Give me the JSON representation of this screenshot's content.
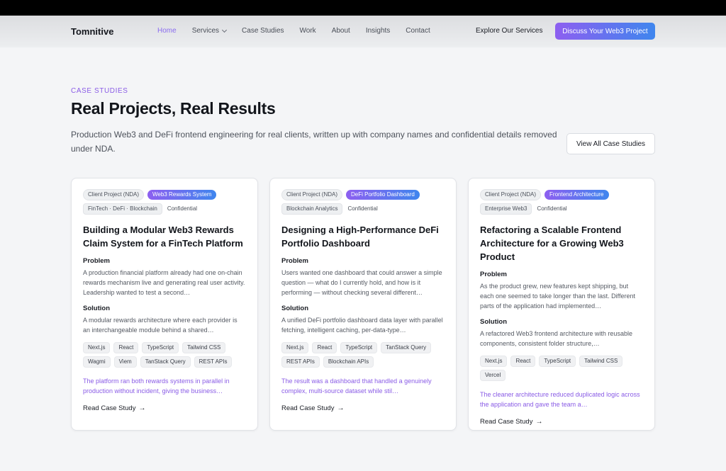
{
  "nav": {
    "logo": "Tomnitive",
    "links": [
      "Home",
      "Services",
      "Case Studies",
      "Work",
      "About",
      "Insights",
      "Contact"
    ],
    "explore": "Explore Our Services",
    "cta": "Discuss Your Web3 Project",
    "active_color": "#8a6cf0"
  },
  "hero": {
    "eyebrow": "CASE STUDIES",
    "title": "Real Projects, Real Results",
    "subtitle": "Production Web3 and DeFi frontend engineering for real clients, written up with company names and confidential details removed under NDA.",
    "view_all": "View All Case Studies"
  },
  "cards": [
    {
      "tag1": "Client Project (NDA)",
      "tag2": "Web3 Rewards System",
      "tag3": "FinTech · DeFi · Blockchain",
      "tag4": "Confidential",
      "title": "Building a Modular Web3 Rewards Claim System for a FinTech Platform",
      "problem_label": "Problem",
      "problem": "A production financial platform already had one on-chain rewards mechanism live and generating real user activity. Leadership wanted to test a second…",
      "solution_label": "Solution",
      "solution": "A modular rewards architecture where each provider is an interchangeable module behind a shared…",
      "tech": [
        "Next.js",
        "React",
        "TypeScript",
        "Tailwind CSS",
        "Wagmi",
        "Viem",
        "TanStack Query",
        "REST APIs"
      ],
      "result": "The platform ran both rewards systems in parallel in production without incident, giving the business…",
      "read": "Read Case Study"
    },
    {
      "tag1": "Client Project (NDA)",
      "tag2": "DeFi Portfolio Dashboard",
      "tag3": "Blockchain Analytics",
      "tag4": "Confidential",
      "title": "Designing a High-Performance DeFi Portfolio Dashboard",
      "problem_label": "Problem",
      "problem": "Users wanted one dashboard that could answer a simple question — what do I currently hold, and how is it performing — without checking several different…",
      "solution_label": "Solution",
      "solution": "A unified DeFi portfolio dashboard data layer with parallel fetching, intelligent caching, per-data-type…",
      "tech": [
        "Next.js",
        "React",
        "TypeScript",
        "TanStack Query",
        "REST APIs",
        "Blockchain APIs"
      ],
      "result": "The result was a dashboard that handled a genuinely complex, multi-source dataset while stil…",
      "read": "Read Case Study"
    },
    {
      "tag1": "Client Project (NDA)",
      "tag2": "Frontend Architecture",
      "tag3": "Enterprise Web3",
      "tag4": "Confidential",
      "title": "Refactoring a Scalable Frontend Architecture for a Growing Web3 Product",
      "problem_label": "Problem",
      "problem": "As the product grew, new features kept shipping, but each one seemed to take longer than the last. Different parts of the application had implemented…",
      "solution_label": "Solution",
      "solution": "A refactored Web3 frontend architecture with reusable components, consistent folder structure,…",
      "tech": [
        "Next.js",
        "React",
        "TypeScript",
        "Tailwind CSS",
        "Vercel"
      ],
      "result": "The cleaner architecture reduced duplicated logic across the application and gave the team a…",
      "read": "Read Case Study"
    }
  ]
}
